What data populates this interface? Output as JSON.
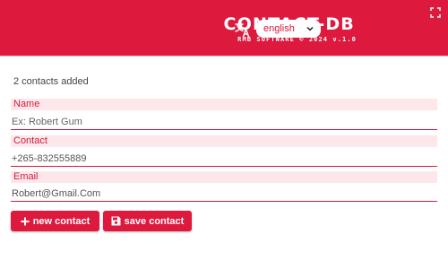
{
  "header": {
    "title": "CONTACT-DB",
    "subtitle": "RMB SOFTWARE © 2024 v.1.0",
    "language_value": "english",
    "brand_color": "#dd1a3e"
  },
  "status": {
    "contacts_added": "2 contacts added"
  },
  "form": {
    "name": {
      "label": "Name",
      "placeholder": "Ex: Robert Gum",
      "value": ""
    },
    "contact": {
      "label": "Contact",
      "placeholder": "",
      "value": "+265-832555889"
    },
    "email": {
      "label": "Email",
      "placeholder": "",
      "value": "Robert@Gmail.Com"
    }
  },
  "buttons": {
    "new_contact": "new contact",
    "save_contact": "save contact"
  },
  "icons": [
    "translate-icon",
    "chevron-down-icon",
    "fullscreen-icon",
    "plus-icon",
    "save-disk-icon"
  ]
}
